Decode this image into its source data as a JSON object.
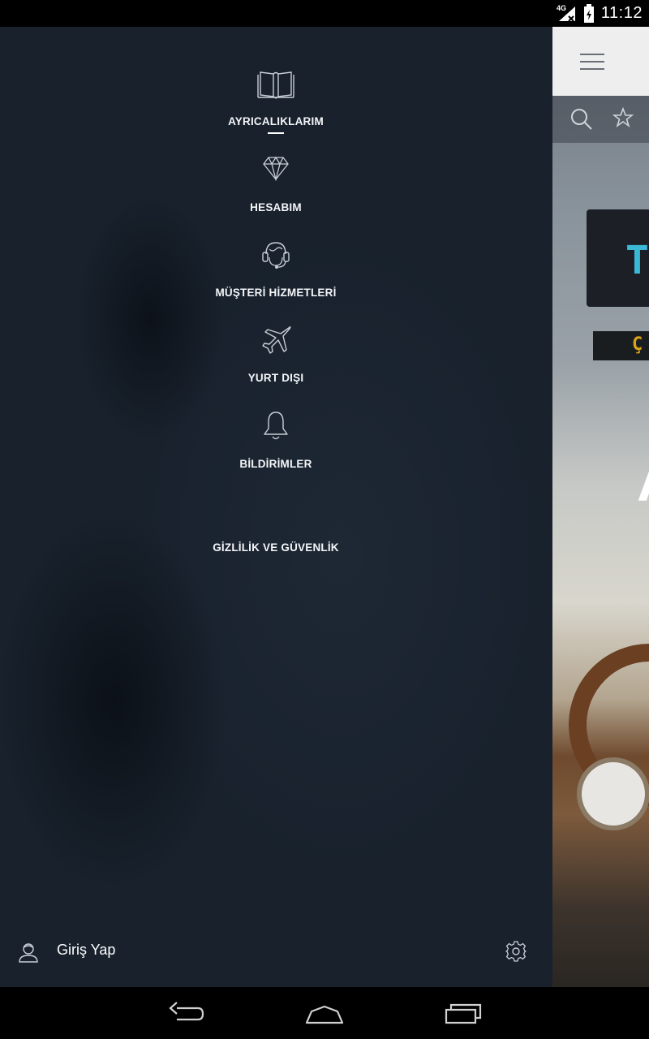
{
  "status_bar": {
    "time": "11:12",
    "network": "4G",
    "icons": [
      "signal-icon",
      "battery-icon"
    ]
  },
  "drawer": {
    "menu": [
      {
        "id": "ayricaliklarim",
        "label": "AYRICALIKLARIM",
        "icon": "book-icon",
        "active": true
      },
      {
        "id": "hesabim",
        "label": "HESABIM",
        "icon": "diamond-icon",
        "active": false
      },
      {
        "id": "musteri-hizmetleri",
        "label": "MÜŞTERİ HİZMETLERİ",
        "icon": "headset-icon",
        "active": false
      },
      {
        "id": "yurt-disi",
        "label": "YURT DIŞI",
        "icon": "airplane-icon",
        "active": false
      },
      {
        "id": "bildirimler",
        "label": "BİLDİRİMLER",
        "icon": "bell-icon",
        "active": false
      },
      {
        "id": "gizlilik",
        "label": "GİZLİLİK VE GÜVENLİK",
        "icon": null,
        "active": false
      }
    ],
    "footer": {
      "login_label": "Giriş Yap",
      "login_icon": "user-icon",
      "settings_icon": "gear-icon"
    }
  },
  "background_app": {
    "toolbar_icons": [
      "hamburger-menu-icon",
      "search-icon",
      "star-icon"
    ],
    "sign_glyph": "T",
    "led_glyph": "Ç",
    "headline_fragment": "A"
  },
  "nav_bar": {
    "buttons": [
      "back-icon",
      "home-icon",
      "recents-icon"
    ]
  }
}
